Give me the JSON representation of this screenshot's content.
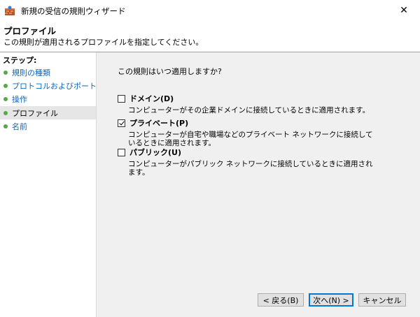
{
  "window": {
    "title": "新規の受信の規則ウィザード",
    "close_glyph": "✕"
  },
  "header": {
    "title": "プロファイル",
    "description": "この規則が適用されるプロファイルを指定してください。"
  },
  "sidebar": {
    "steps_label": "ステップ:",
    "items": [
      {
        "label": "規則の種類",
        "active": false
      },
      {
        "label": "プロトコルおよびポート",
        "active": false
      },
      {
        "label": "操作",
        "active": false
      },
      {
        "label": "プロファイル",
        "active": true
      },
      {
        "label": "名前",
        "active": false
      }
    ]
  },
  "main": {
    "question": "この規則はいつ適用しますか?",
    "options": [
      {
        "label": "ドメイン(D)",
        "checked": false,
        "description": "コンピューターがその企業ドメインに接続しているときに適用されます。"
      },
      {
        "label": "プライベート(P)",
        "checked": true,
        "description": "コンピューターが自宅や職場などのプライベート ネットワークに接続しているときに適用されます。"
      },
      {
        "label": "パブリック(U)",
        "checked": false,
        "description": "コンピューターがパブリック ネットワークに接続しているときに適用されます。"
      }
    ]
  },
  "buttons": {
    "back": "< 戻る(B)",
    "next": "次へ(N) >",
    "cancel": "キャンセル"
  },
  "colors": {
    "link": "#0a66c2",
    "step_dot": "#5aa64a",
    "primary_border": "#0078d7"
  }
}
